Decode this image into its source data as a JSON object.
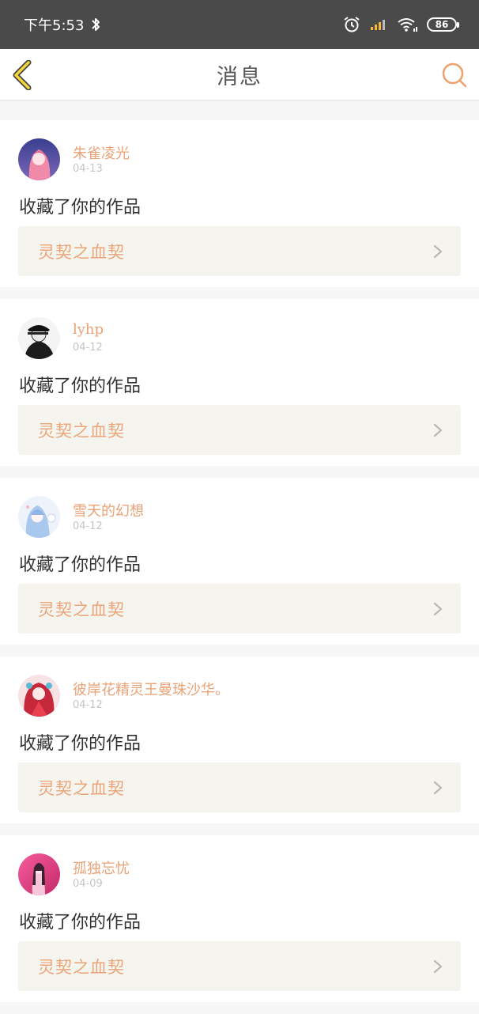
{
  "status": {
    "time": "下午5:53",
    "battery": "86"
  },
  "header": {
    "title": "消息",
    "back_icon": "back-chevron-icon",
    "search_icon": "search-icon",
    "accent_color": "#e8a276"
  },
  "messages": [
    {
      "user": "朱雀凌光",
      "date": "04-13",
      "action": "收藏了你的作品",
      "work": "灵契之血契"
    },
    {
      "user": "lyhp",
      "date": "04-12",
      "action": "收藏了你的作品",
      "work": "灵契之血契"
    },
    {
      "user": "雪天的幻想",
      "date": "04-12",
      "action": "收藏了你的作品",
      "work": "灵契之血契"
    },
    {
      "user": "彼岸花精灵王曼珠沙华。",
      "date": "04-12",
      "action": "收藏了你的作品",
      "work": "灵契之血契"
    },
    {
      "user": "孤独忘忧",
      "date": "04-09",
      "action": "收藏了你的作品",
      "work": "灵契之血契"
    }
  ]
}
